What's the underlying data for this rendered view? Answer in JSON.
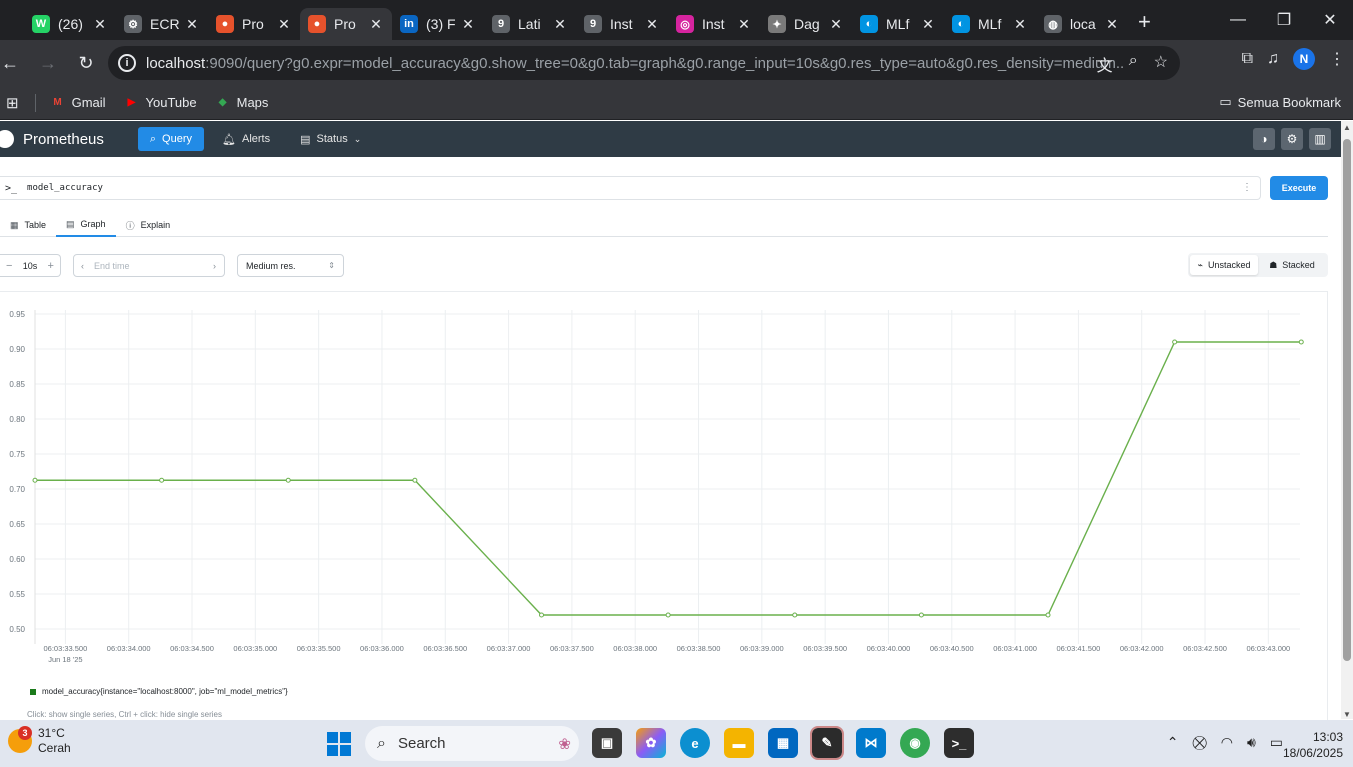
{
  "browser": {
    "tabs": [
      {
        "label": "(26)",
        "icon": "whatsapp-icon",
        "color": "#25d366",
        "glyph": "W"
      },
      {
        "label": "ECR",
        "icon": "gear-icon",
        "color": "#5f6368",
        "glyph": "⚙"
      },
      {
        "label": "Pro",
        "icon": "prometheus-icon",
        "color": "#e6522c",
        "glyph": "●"
      },
      {
        "label": "Pro",
        "icon": "prometheus-icon",
        "color": "#e6522c",
        "glyph": "●"
      },
      {
        "label": "(3) F",
        "icon": "linkedin-icon",
        "color": "#0a66c2",
        "glyph": "in"
      },
      {
        "label": "Lati",
        "icon": "glitch-icon",
        "color": "#5f6368",
        "glyph": "9"
      },
      {
        "label": "Inst",
        "icon": "glitch-icon",
        "color": "#5f6368",
        "glyph": "9"
      },
      {
        "label": "Inst",
        "icon": "instagram-icon",
        "color": "#d6249f",
        "glyph": "◎"
      },
      {
        "label": "Dag",
        "icon": "dagster-icon",
        "color": "#7a7a7a",
        "glyph": "✦"
      },
      {
        "label": "MLf",
        "icon": "mlflow-icon",
        "color": "#0194e2",
        "glyph": "◐"
      },
      {
        "label": "MLf",
        "icon": "mlflow-icon",
        "color": "#0194e2",
        "glyph": "◐"
      },
      {
        "label": "loca",
        "icon": "globe-icon",
        "color": "#5f6368",
        "glyph": "◍"
      }
    ],
    "active_tab": 3,
    "url_host": "localhost",
    "url_rest": ":9090/query?g0.expr=model_accuracy&g0.show_tree=0&g0.tab=graph&g0.range_input=10s&g0.res_type=auto&g0.res_density=medium...",
    "bookmarks": [
      {
        "label": "Gmail",
        "icon": "gmail-icon",
        "color": "#ea4335",
        "glyph": "M"
      },
      {
        "label": "YouTube",
        "icon": "youtube-icon",
        "color": "#ff0000",
        "glyph": "▶"
      },
      {
        "label": "Maps",
        "icon": "maps-icon",
        "color": "#34a853",
        "glyph": "◆"
      }
    ],
    "all_bookmarks": "Semua Bookmark",
    "profile_initial": "N"
  },
  "prometheus": {
    "brand": "Prometheus",
    "nav": {
      "query": "Query",
      "alerts": "Alerts",
      "status": "Status"
    },
    "query_expr": "model_accuracy",
    "execute": "Execute",
    "tabs": {
      "table": "Table",
      "graph": "Graph",
      "explain": "Explain"
    },
    "range": "10s",
    "end_time_placeholder": "End time",
    "resolution": "Medium res.",
    "unstacked": "Unstacked",
    "stacked": "Stacked",
    "legend": "model_accuracy{instance=\"localhost:8000\", job=\"ml_model_metrics\"}",
    "hint": "Click: show single series, Ctrl + click: hide single series"
  },
  "chart_data": {
    "type": "line",
    "xlabel": "",
    "ylabel": "",
    "x_ticks": [
      "06:03:33.500",
      "06:03:34.000",
      "06:03:34.500",
      "06:03:35.000",
      "06:03:35.500",
      "06:03:36.000",
      "06:03:36.500",
      "06:03:37.000",
      "06:03:37.500",
      "06:03:38.000",
      "06:03:38.500",
      "06:03:39.000",
      "06:03:39.500",
      "06:03:40.000",
      "06:03:40.500",
      "06:03:41.000",
      "06:03:41.500",
      "06:03:42.000",
      "06:03:42.500",
      "06:03:43.000"
    ],
    "x_date_label": "Jun 18 '25",
    "y_ticks": [
      "0.95",
      "0.90",
      "0.85",
      "0.80",
      "0.75",
      "0.70",
      "0.65",
      "0.60",
      "0.55",
      "0.50"
    ],
    "ylim": [
      0.49,
      0.95
    ],
    "xlim": [
      33.26,
      43.25
    ],
    "series": [
      {
        "name": "model_accuracy{instance=\"localhost:8000\", job=\"ml_model_metrics\"}",
        "color": "#6ab04c",
        "x": [
          33.26,
          34.26,
          35.26,
          36.26,
          37.26,
          38.26,
          39.26,
          40.26,
          41.26,
          42.26,
          43.26
        ],
        "y": [
          0.7125,
          0.7125,
          0.7125,
          0.7125,
          0.52,
          0.52,
          0.52,
          0.52,
          0.52,
          0.91,
          0.91
        ]
      }
    ],
    "grid": true
  },
  "taskbar": {
    "temperature": "31°C",
    "condition": "Cerah",
    "weather_badge": "3",
    "search": "Search",
    "time": "13:03",
    "date": "18/06/2025"
  }
}
